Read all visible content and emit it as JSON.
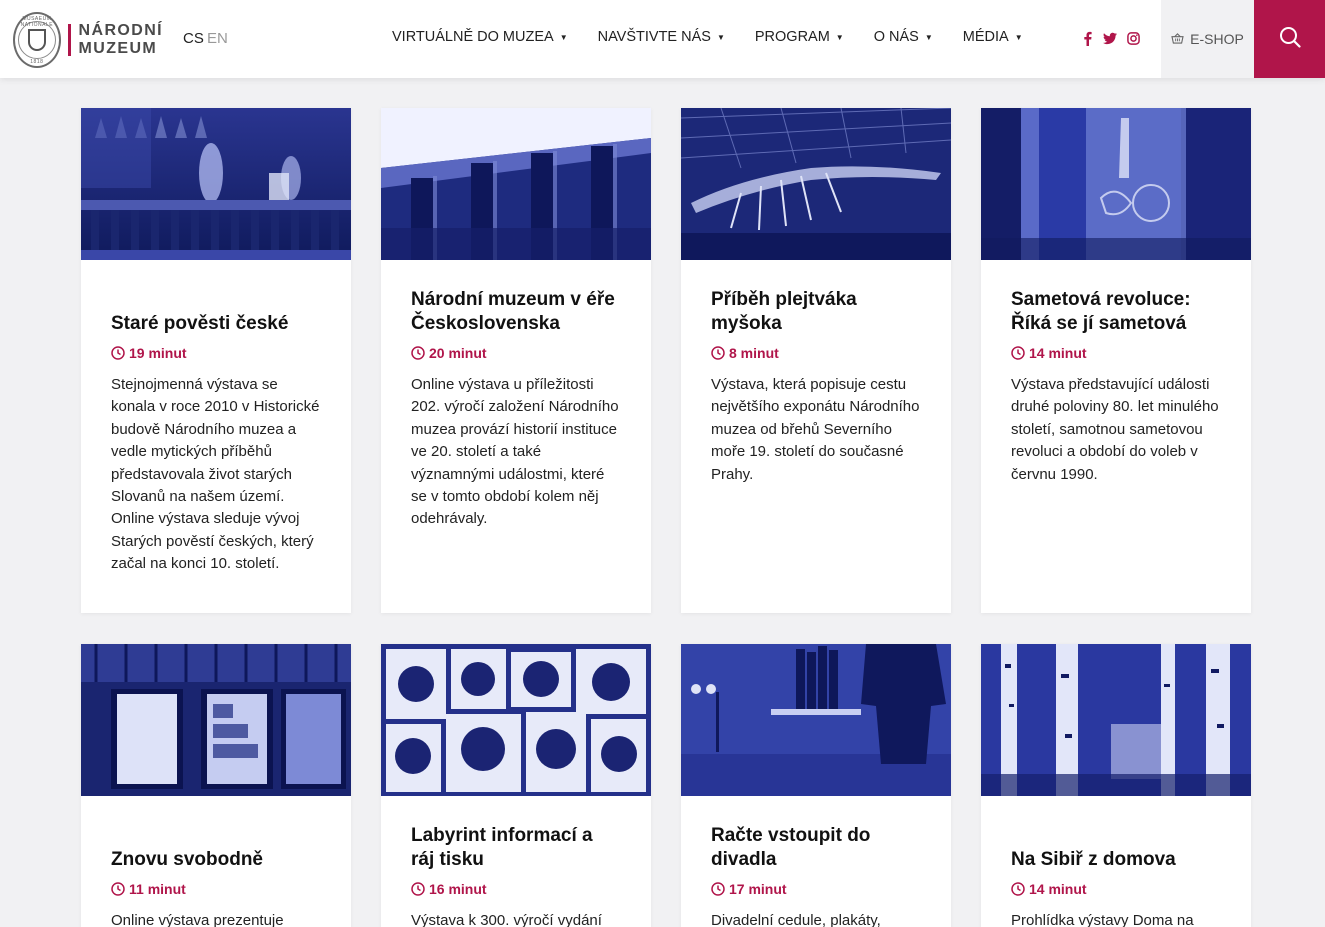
{
  "header": {
    "logo_line1": "NÁRODNÍ",
    "logo_line2": "MUZEUM",
    "seal_top": "MUSAEUM NATIONALE",
    "seal_bottom": "1818",
    "lang_cs": "CS",
    "lang_en": "EN",
    "nav": [
      "VIRTUÁLNĚ DO MUZEA",
      "NAVŠTIVTE NÁS",
      "PROGRAM",
      "O NÁS",
      "MÉDIA"
    ],
    "eshop_label": "E-SHOP",
    "social_icons": [
      "facebook-icon",
      "twitter-icon",
      "instagram-icon"
    ],
    "accent_color": "#b0154a"
  },
  "cards": [
    {
      "title": "Staré pověsti české",
      "time": "19 minut",
      "desc": "Stejnojmenná výstava se konala v roce 2010 v Historické budově Národního muzea a vedle mytických příběhů představovala život starých Slovanů na našem území. Online výstava sleduje vývoj Starých pověstí českých, který začal na konci 10. století."
    },
    {
      "title": "Národní muzeum v éře Československa",
      "time": "20 minut",
      "desc": "Online výstava u příležitosti 202. výročí založení Národního muzea provází historií instituce ve 20. století a také významnými událostmi, které se v tomto období kolem něj odehrávaly."
    },
    {
      "title": "Příběh plejtváka myšoka",
      "time": "8 minut",
      "desc": "Výstava, která popisuje cestu největšího exponátu Národního muzea od břehů Severního moře 19. století do současné Prahy."
    },
    {
      "title": "Sametová revoluce: Říká se jí sametová",
      "time": "14 minut",
      "desc": "Výstava představující události druhé poloviny 80. let minulého století, samotnou sametovou revoluci a období do voleb v červnu 1990."
    },
    {
      "title": "Znovu svobodně",
      "time": "11 minut",
      "desc": "Online výstava prezentuje"
    },
    {
      "title": "Labyrint informací a ráj tisku",
      "time": "16 minut",
      "desc": "Výstava k 300. výročí vydání"
    },
    {
      "title": "Račte vstoupit do divadla",
      "time": "17 minut",
      "desc": "Divadelní cedule, plakáty,"
    },
    {
      "title": "Na Sibiř z domova",
      "time": "14 minut",
      "desc": "Prohlídka výstavy Doma na"
    }
  ]
}
